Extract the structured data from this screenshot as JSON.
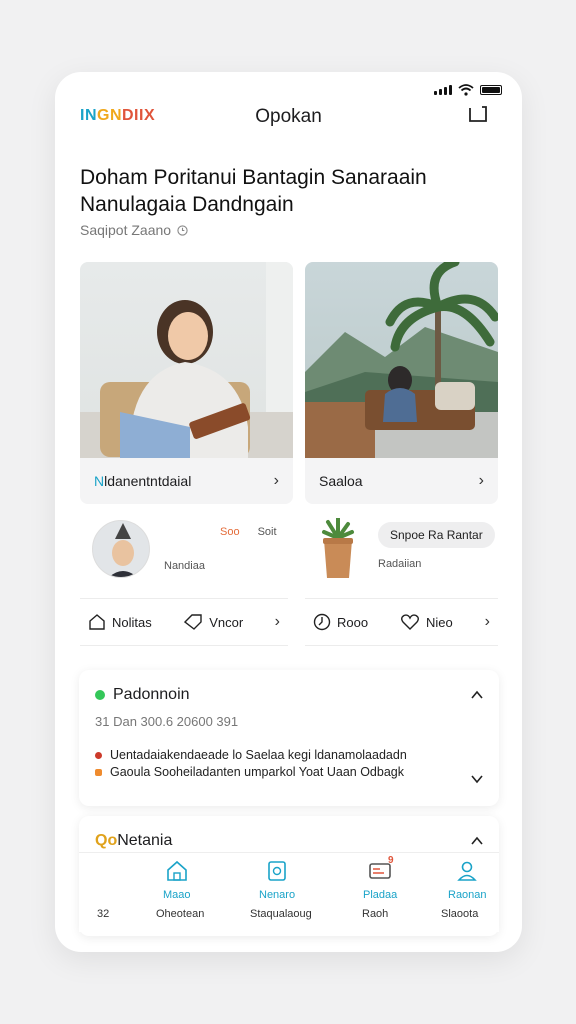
{
  "brand": {
    "logo_part1": "IN",
    "logo_part2": "GN",
    "logo_part3": "DIIX"
  },
  "header": {
    "title": "Opokan"
  },
  "hero": {
    "headline": "Doham Poritanui Bantagin Sanaraain Nanulagaia Dandngain",
    "sub": "Saqipot Zaano",
    "sub_icon": "clock-icon"
  },
  "cards": [
    {
      "label_accent": "N",
      "label": "ldanentntdaial",
      "image": "woman-reading-photo"
    },
    {
      "label": "Saaloa",
      "image": "terrace-palm-photo"
    }
  ],
  "profiles": [
    {
      "name": "Nandiaa",
      "stat_a": "Soo",
      "stat_b": "Soit",
      "stat_a_color": "#e46c3a"
    },
    {
      "name": "Radaiian",
      "pill": "Snpoe Ra Rantar"
    }
  ],
  "actions_left": [
    {
      "label": "Nolitas",
      "icon": "home-icon"
    },
    {
      "label": "Vncor",
      "icon": "tag-icon"
    }
  ],
  "actions_right": [
    {
      "label": "Rooo",
      "icon": "clock-icon"
    },
    {
      "label": "Nieo",
      "icon": "heart-icon"
    }
  ],
  "panel1": {
    "title": "Padonnoin",
    "status_color": "#34c759",
    "meta": "31 Dan 300.6 20600 391",
    "lines": [
      {
        "text": "Uentadaiakendaeade lo Saelaa kegi ldanamolaadadn",
        "color": "#cc3a2a"
      },
      {
        "text": "Gaoula Sooheiladanten umparkol Yoat Uaan Odbagk",
        "color": "#ef8b2e"
      }
    ]
  },
  "panel2": {
    "title_prefix": "Qo",
    "title": "Netania"
  },
  "tabs": [
    {
      "label": "Maao",
      "sub": "32",
      "icon": "home-icon"
    },
    {
      "label": "Nenaro",
      "sub": "Oheotean",
      "icon": "document-icon"
    },
    {
      "label": "Pladaa",
      "sub": "Staqualaoug",
      "icon": "inbox-icon",
      "badge": "9"
    },
    {
      "label": "Raonan",
      "sub": "Raoh",
      "icon": "user-icon"
    }
  ],
  "tab_extra_sub": "Slaoota",
  "colors": {
    "accent": "#1aa3c8",
    "green": "#34c759"
  }
}
